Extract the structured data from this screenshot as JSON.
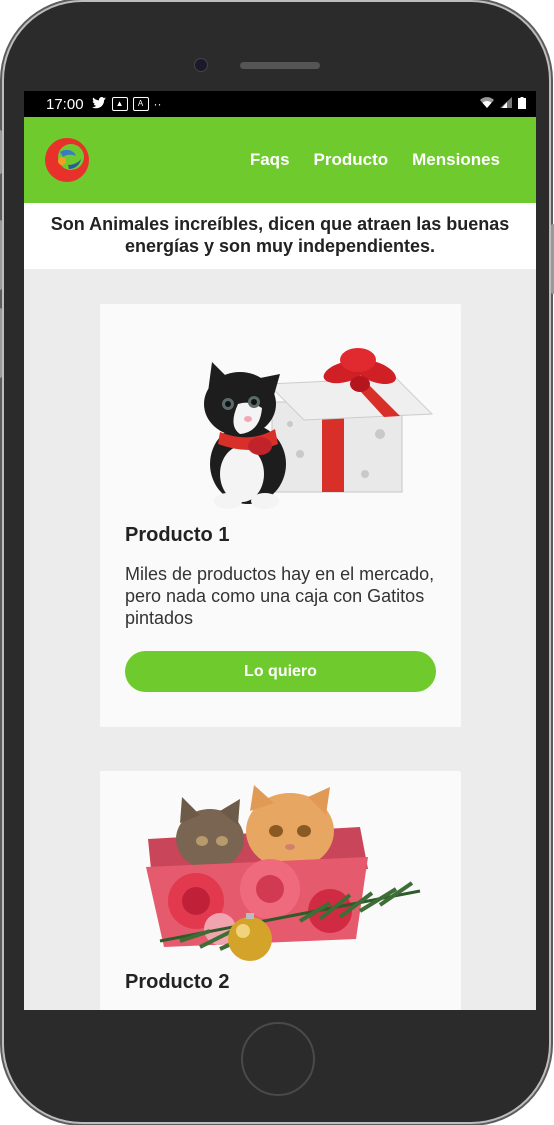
{
  "status_bar": {
    "time": "17:00",
    "left_icons": [
      "twitter-icon",
      "image-icon",
      "accessibility-icon",
      "more-icon"
    ],
    "right_icons": [
      "wifi-icon",
      "signal-icon",
      "battery-icon"
    ]
  },
  "nav": {
    "logo": "brand-logo",
    "links": [
      "Faqs",
      "Producto",
      "Mensiones"
    ]
  },
  "intro_text": "Son Animales increíbles, dicen que atraen las buenas energías y son muy independientes.",
  "cards": [
    {
      "title": "Producto 1",
      "description": "Miles de productos hay en el mercado, pero nada como una caja con Gatitos pintados",
      "button": "Lo quiero",
      "image": "kitten-with-gift-box"
    },
    {
      "title": "Producto 2",
      "image": "kittens-in-gift-box"
    }
  ],
  "colors": {
    "accent": "#6fcb2d",
    "screen_bg": "#ececec",
    "card_bg": "#fafafa"
  }
}
